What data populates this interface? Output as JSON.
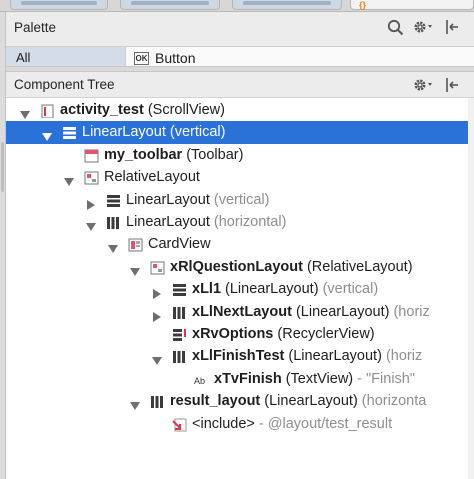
{
  "palette": {
    "title": "Palette",
    "category": "All",
    "item_badge": "OK",
    "item_label": "Button"
  },
  "component_tree": {
    "title": "Component Tree",
    "rows": [
      {
        "name": "activity_test",
        "type": "(ScrollView)",
        "icon": "layout-file-icon",
        "arrow": "down",
        "bold": true
      },
      {
        "name": "LinearLayout",
        "type": "(vertical)",
        "icon": "linearlayout-vertical-icon",
        "arrow": "down",
        "bold": false,
        "selected": true
      },
      {
        "name": "my_toolbar",
        "type": "(Toolbar)",
        "icon": "toolbar-icon",
        "arrow": "none",
        "bold": true
      },
      {
        "name": "RelativeLayout",
        "type": "",
        "icon": "relativelayout-icon",
        "arrow": "down",
        "bold": false
      },
      {
        "name": "LinearLayout",
        "type": "(vertical)",
        "icon": "linearlayout-vertical-icon",
        "arrow": "right",
        "bold": false,
        "type_muted": true
      },
      {
        "name": "LinearLayout",
        "type": "(horizontal)",
        "icon": "linearlayout-horizontal-icon",
        "arrow": "down",
        "bold": false,
        "type_muted": true
      },
      {
        "name": "CardView",
        "type": "",
        "icon": "cardview-icon",
        "arrow": "down",
        "bold": false
      },
      {
        "name": "xRlQuestionLayout",
        "type": "(RelativeLayout)",
        "icon": "relativelayout-icon",
        "arrow": "down",
        "bold": true
      },
      {
        "name": "xLl1",
        "type": "(LinearLayout)",
        "extra": "(vertical)",
        "icon": "linearlayout-vertical-icon",
        "arrow": "right",
        "bold": true
      },
      {
        "name": "xLlNextLayout",
        "type": "(LinearLayout)",
        "extra": "(horiz",
        "icon": "linearlayout-horizontal-icon",
        "arrow": "right",
        "bold": true
      },
      {
        "name": "xRvOptions",
        "type": "(RecyclerView)",
        "icon": "recyclerview-icon",
        "arrow": "none",
        "bold": true
      },
      {
        "name": "xLlFinishTest",
        "type": "(LinearLayout)",
        "extra": "(horiz",
        "icon": "linearlayout-horizontal-icon",
        "arrow": "down",
        "bold": true
      },
      {
        "name": "xTvFinish",
        "type": "(TextView)",
        "extra": "- \"Finish\"",
        "icon": "textview-icon",
        "arrow": "none",
        "bold": true
      },
      {
        "name": "result_layout",
        "type": "(LinearLayout)",
        "extra": "(horizonta",
        "icon": "linearlayout-horizontal-icon",
        "arrow": "down",
        "bold": true
      },
      {
        "name": "<include>",
        "type": "",
        "extra": "- @layout/test_result",
        "icon": "include-icon",
        "arrow": "none",
        "bold": false
      }
    ]
  },
  "icons": {
    "search": "search-icon",
    "settings": "gear-icon",
    "hide": "hide-panel-icon"
  },
  "colors": {
    "selection": "#2a72d8",
    "palette_category_bg": "#d3dce7",
    "muted_text": "#8e8e8e"
  }
}
